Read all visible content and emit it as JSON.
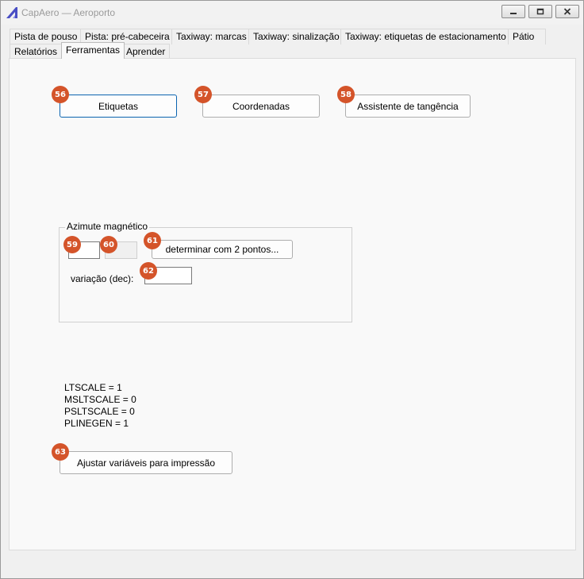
{
  "window": {
    "title": "CapAero — Aeroporto",
    "controls": [
      "minimize-icon",
      "maximize-icon",
      "close-icon"
    ]
  },
  "tabs": {
    "row1": [
      {
        "label": "Pista de pouso"
      },
      {
        "label": "Pista: pré-cabeceira"
      },
      {
        "label": "Taxiway: marcas"
      },
      {
        "label": "Taxiway: sinalização"
      },
      {
        "label": "Taxiway: etiquetas de estacionamento"
      },
      {
        "label": "Pátio"
      }
    ],
    "row2": [
      {
        "label": "Relatórios"
      },
      {
        "label": "Ferramentas",
        "active": true
      },
      {
        "label": "Aprender"
      }
    ]
  },
  "tools": {
    "labels_button": {
      "badge": "56",
      "label": "Etiquetas"
    },
    "coords_button": {
      "badge": "57",
      "label": "Coordenadas"
    },
    "tangent_button": {
      "badge": "58",
      "label": "Assistente de tangência"
    }
  },
  "azimuth": {
    "title": "Azimute magnético",
    "field1": {
      "badge": "59",
      "value": ""
    },
    "field2": {
      "badge": "60",
      "value": ""
    },
    "determine_button": {
      "badge": "61",
      "label": "determinar com 2 pontos..."
    },
    "variation_label": "variação (dec):",
    "variation_field": {
      "badge": "62",
      "value": ""
    }
  },
  "variables": [
    "LTSCALE = 1",
    "MSLTSCALE = 0",
    "PSLTSCALE = 0",
    "PLINEGEN = 1"
  ],
  "print_button": {
    "badge": "63",
    "label": "Ajustar variáveis para impressão"
  },
  "colors": {
    "badge": "#d4542a",
    "focus": "#0b64b0",
    "panel": "#f9f9f9"
  }
}
